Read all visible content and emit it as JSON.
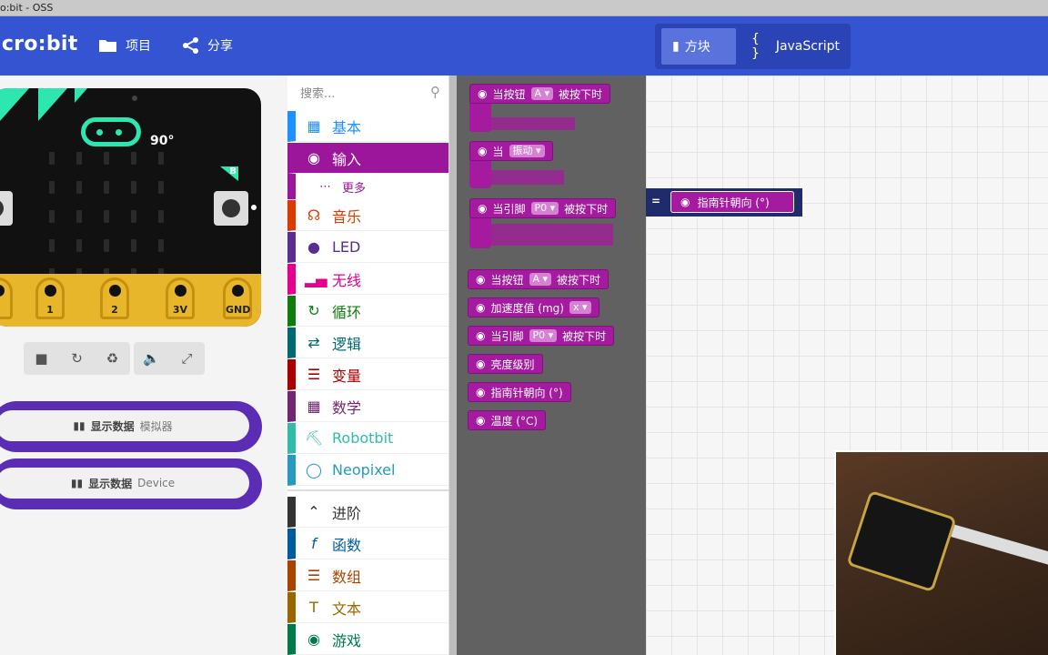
{
  "window": {
    "title": "o:bit - OSS"
  },
  "header": {
    "brand": "icro:bit",
    "projects_label": "项目",
    "share_label": "分享",
    "blocks_label": "方块",
    "js_label": "JavaScript",
    "colors": {
      "bg": "#3454d1"
    }
  },
  "simulator": {
    "compass_reading": "90°",
    "button_b_label": "B",
    "pins": [
      "1",
      "2",
      "3V",
      "GND"
    ],
    "controls": [
      "stop-icon",
      "restart-icon",
      "slowmo-icon",
      "sound-icon",
      "fullscreen-icon"
    ],
    "data_buttons": [
      {
        "label": "显示数据",
        "source": "模拟器"
      },
      {
        "label": "显示数据",
        "source": "Device"
      }
    ]
  },
  "toolbox": {
    "search_placeholder": "搜索...",
    "categories": [
      {
        "label": "基本",
        "color": "#1e90ff"
      },
      {
        "label": "输入",
        "color": "#9c169c"
      },
      {
        "label": "更多",
        "color": "#9c169c"
      },
      {
        "label": "音乐",
        "color": "#d83b01"
      },
      {
        "label": "LED",
        "color": "#5c2d91"
      },
      {
        "label": "无线",
        "color": "#e3008c"
      },
      {
        "label": "循环",
        "color": "#107c10"
      },
      {
        "label": "逻辑",
        "color": "#006970"
      },
      {
        "label": "变量",
        "color": "#a80000"
      },
      {
        "label": "数学",
        "color": "#712672"
      },
      {
        "label": "Robotbit",
        "color": "#31bca9"
      },
      {
        "label": "Neopixel",
        "color": "#2699bf"
      }
    ],
    "advanced": [
      {
        "label": "进阶",
        "color": "#333333"
      },
      {
        "label": "函数",
        "color": "#005a9e"
      },
      {
        "label": "数组",
        "color": "#a94400"
      },
      {
        "label": "文本",
        "color": "#996600"
      },
      {
        "label": "游戏",
        "color": "#007a4b"
      }
    ]
  },
  "flyout": {
    "hats": [
      {
        "prefix": "当按钮",
        "drop": "A ▾",
        "suffix": "被按下时"
      },
      {
        "prefix": "当",
        "drop": "振动 ▾",
        "suffix": ""
      },
      {
        "prefix": "当引脚",
        "drop": "P0 ▾",
        "suffix": "被按下时"
      }
    ],
    "reporters": [
      {
        "prefix": "当按钮",
        "drop": "A ▾",
        "suffix": "被按下时"
      },
      {
        "prefix": "加速度值 (mg)",
        "drop": "x ▾",
        "suffix": ""
      },
      {
        "prefix": "当引脚",
        "drop": "P0 ▾",
        "suffix": "被按下时"
      },
      {
        "prefix": "亮度级别",
        "drop": "",
        "suffix": ""
      },
      {
        "prefix": "指南针朝向 (°)",
        "drop": "",
        "suffix": ""
      },
      {
        "prefix": "温度 (°C)",
        "drop": "",
        "suffix": ""
      }
    ]
  },
  "workspace": {
    "eq_label": "=",
    "block_label": "指南针朝向 (°)"
  }
}
